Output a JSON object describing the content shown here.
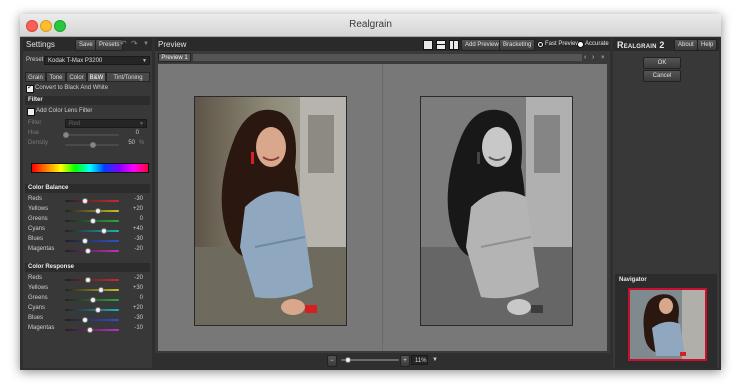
{
  "app": {
    "title": "Realgrain"
  },
  "left": {
    "header": "Settings",
    "save_label": "Save",
    "presets_label": "Presets",
    "preset_label": "Preset",
    "preset_value": "Kodak T-Max P3200",
    "tabs": [
      "Grain",
      "Tone",
      "Color",
      "B&W",
      "Tint/Toning"
    ],
    "convert_label": "Convert to Black And White",
    "filter": {
      "header": "Filter",
      "add_lens_label": "Add Color Lens Filter",
      "filter_label": "Filter",
      "filter_value": "Red",
      "hue_label": "Hue",
      "hue_value": "0",
      "density_label": "Density",
      "density_value": "50",
      "density_unit": "%"
    },
    "color_balance": {
      "header": "Color Balance",
      "rows": [
        {
          "label": "Reds",
          "value": "-30",
          "pos": 0.35,
          "color": "#cc2a2a"
        },
        {
          "label": "Yellows",
          "value": "+20",
          "pos": 0.6,
          "color": "#c8c020"
        },
        {
          "label": "Greens",
          "value": "0",
          "pos": 0.5,
          "color": "#2aa83a"
        },
        {
          "label": "Cyans",
          "value": "+40",
          "pos": 0.7,
          "color": "#20b0c0"
        },
        {
          "label": "Blues",
          "value": "-30",
          "pos": 0.35,
          "color": "#3050d0"
        },
        {
          "label": "Magentas",
          "value": "-20",
          "pos": 0.4,
          "color": "#c030c0"
        }
      ]
    },
    "color_response": {
      "header": "Color Response",
      "rows": [
        {
          "label": "Reds",
          "value": "-20",
          "pos": 0.4,
          "color": "#cc2a2a"
        },
        {
          "label": "Yellows",
          "value": "+30",
          "pos": 0.65,
          "color": "#c8c020"
        },
        {
          "label": "Greens",
          "value": "0",
          "pos": 0.5,
          "color": "#2aa83a"
        },
        {
          "label": "Cyans",
          "value": "+20",
          "pos": 0.6,
          "color": "#20b0c0"
        },
        {
          "label": "Blues",
          "value": "-30",
          "pos": 0.35,
          "color": "#3050d0"
        },
        {
          "label": "Magentas",
          "value": "-10",
          "pos": 0.45,
          "color": "#c030c0"
        }
      ]
    }
  },
  "mid": {
    "header": "Preview",
    "add_preview_label": "Add Preview",
    "bracketing_label": "Bracketing",
    "fast_preview_label": "Fast Preview",
    "accurate_label": "Accurate",
    "preview_tab_label": "Preview 1",
    "zoom_label": "11%"
  },
  "right": {
    "brand_1": "Realgrain",
    "brand_2": "2",
    "about_label": "About",
    "help_label": "Help",
    "ok_label": "OK",
    "cancel_label": "Cancel",
    "navigator_label": "Navigator"
  },
  "colors": {
    "window_bg": "#2f2f2f",
    "panel_bg": "#383838",
    "preview_bg": "#787878",
    "accent_red": "#c8102e"
  }
}
